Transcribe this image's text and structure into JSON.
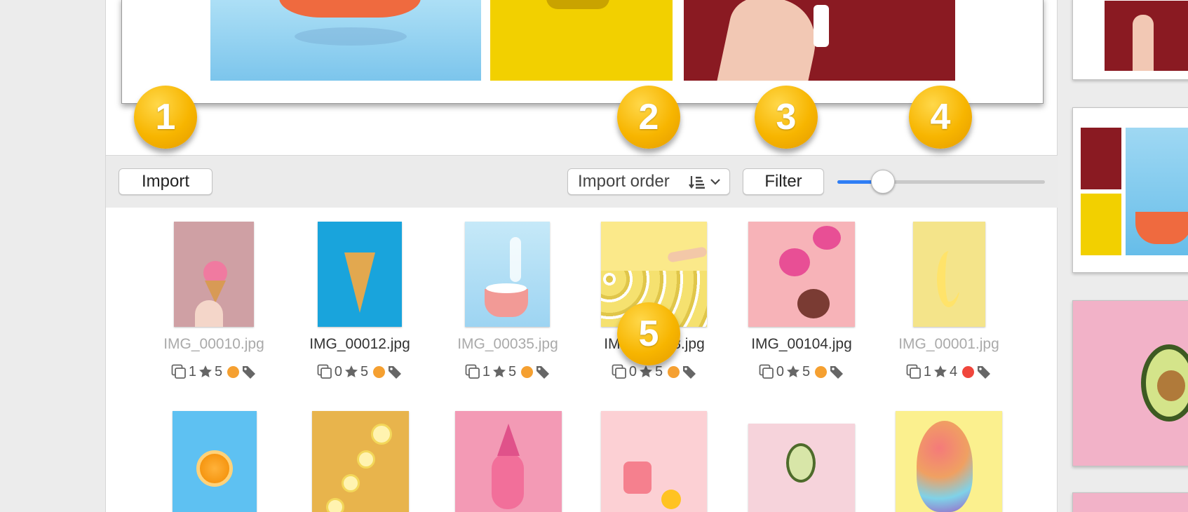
{
  "toolbar": {
    "import_label": "Import",
    "sort_label": "Import order",
    "filter_label": "Filter",
    "thumb_size_fraction": 0.22
  },
  "callouts": [
    "1",
    "2",
    "3",
    "4",
    "5"
  ],
  "grid": {
    "row1": [
      {
        "name": "IMG_00010.jpg",
        "count": "1",
        "rating": "5",
        "color": "#f5a031",
        "selected": false
      },
      {
        "name": "IMG_00012.jpg",
        "count": "0",
        "rating": "5",
        "color": "#f5a031",
        "selected": true
      },
      {
        "name": "IMG_00035.jpg",
        "count": "1",
        "rating": "5",
        "color": "#f5a031",
        "selected": false
      },
      {
        "name": "IMG_00098.jpg",
        "count": "0",
        "rating": "5",
        "color": "#f5a031",
        "selected": true
      },
      {
        "name": "IMG_00104.jpg",
        "count": "0",
        "rating": "5",
        "color": "#f5a031",
        "selected": true
      },
      {
        "name": "IMG_00001.jpg",
        "count": "1",
        "rating": "4",
        "color": "#f0463c",
        "selected": false
      }
    ]
  },
  "icons": [
    "photo-stack-icon",
    "star-icon",
    "color-label-dot",
    "tag-icon",
    "sort-order-icon",
    "chevron-down-icon"
  ],
  "colors": {
    "accent": "#2f7ef5",
    "badge": "#f7b500"
  }
}
